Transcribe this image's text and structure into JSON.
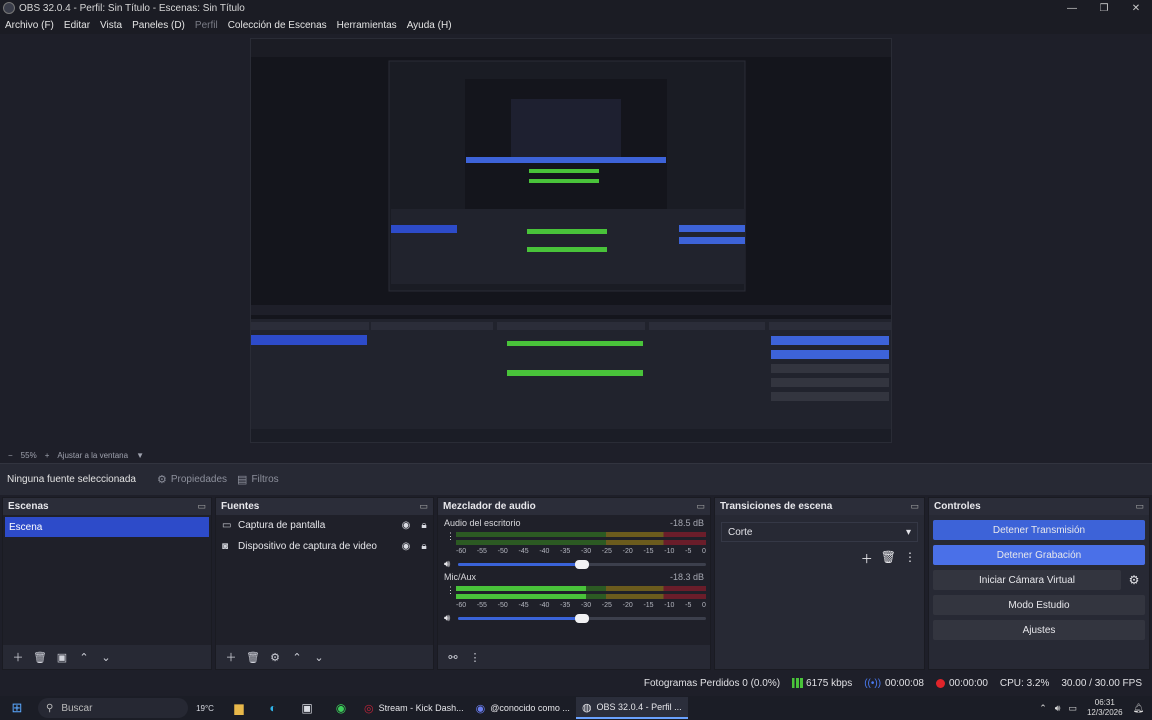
{
  "window": {
    "title": "OBS 32.0.4 - Perfil: Sin Título - Escenas: Sin Título"
  },
  "menu": [
    {
      "label": "Archivo (F)",
      "disabled": false
    },
    {
      "label": "Editar",
      "disabled": false
    },
    {
      "label": "Vista",
      "disabled": false
    },
    {
      "label": "Paneles (D)",
      "disabled": false
    },
    {
      "label": "Perfil",
      "disabled": true
    },
    {
      "label": "Colección de Escenas",
      "disabled": false
    },
    {
      "label": "Herramientas",
      "disabled": false
    },
    {
      "label": "Ayuda (H)",
      "disabled": false
    }
  ],
  "zoom": {
    "minus": "−",
    "value": "55%",
    "plus": "+",
    "fit": "Ajustar a la ventana"
  },
  "source_toolbar": {
    "no_source": "Ninguna fuente seleccionada",
    "properties": "Propiedades",
    "filters": "Filtros"
  },
  "scenes": {
    "title": "Escenas",
    "items": [
      "Escena"
    ]
  },
  "sources": {
    "title": "Fuentes",
    "items": [
      {
        "label": "Captura de pantalla",
        "icon": "monitor-icon"
      },
      {
        "label": "Dispositivo de captura de video",
        "icon": "camera-icon"
      }
    ]
  },
  "mixer": {
    "title": "Mezclador de audio",
    "ticks": [
      "-60",
      "-55",
      "-50",
      "-45",
      "-40",
      "-35",
      "-30",
      "-25",
      "-20",
      "-15",
      "-10",
      "-5",
      "0"
    ],
    "channels": [
      {
        "name": "Audio del escritorio",
        "db": "-18.5 dB",
        "level": 0,
        "volume": 0.5
      },
      {
        "name": "Mic/Aux",
        "db": "-18.3 dB",
        "level": 0.52,
        "volume": 0.5
      }
    ]
  },
  "transitions": {
    "title": "Transiciones de escena",
    "selected": "Corte"
  },
  "controls": {
    "title": "Controles",
    "stop_stream": "Detener Transmisión",
    "stop_record": "Detener Grabación",
    "virtual_cam": "Iniciar Cámara Virtual",
    "studio_mode": "Modo Estudio",
    "settings": "Ajustes"
  },
  "status": {
    "dropped": "Fotogramas Perdidos 0 (0.0%)",
    "bitrate": "6175 kbps",
    "stream_time": "00:00:08",
    "rec_time": "00:00:00",
    "cpu": "CPU: 3.2%",
    "fps": "30.00 / 30.00 FPS"
  },
  "taskbar": {
    "search": "Buscar",
    "weather": "19°C",
    "tasks": [
      {
        "label": "Stream - Kick Dash...",
        "active": false
      },
      {
        "label": "@conocido como ...",
        "active": false
      },
      {
        "label": "OBS 32.0.4 - Perfil ...",
        "active": true
      }
    ],
    "time": "06:31",
    "date": "12/3/2026"
  },
  "colors": {
    "accent": "#3d63d8",
    "panel": "#272934",
    "background": "#1e1f29"
  }
}
